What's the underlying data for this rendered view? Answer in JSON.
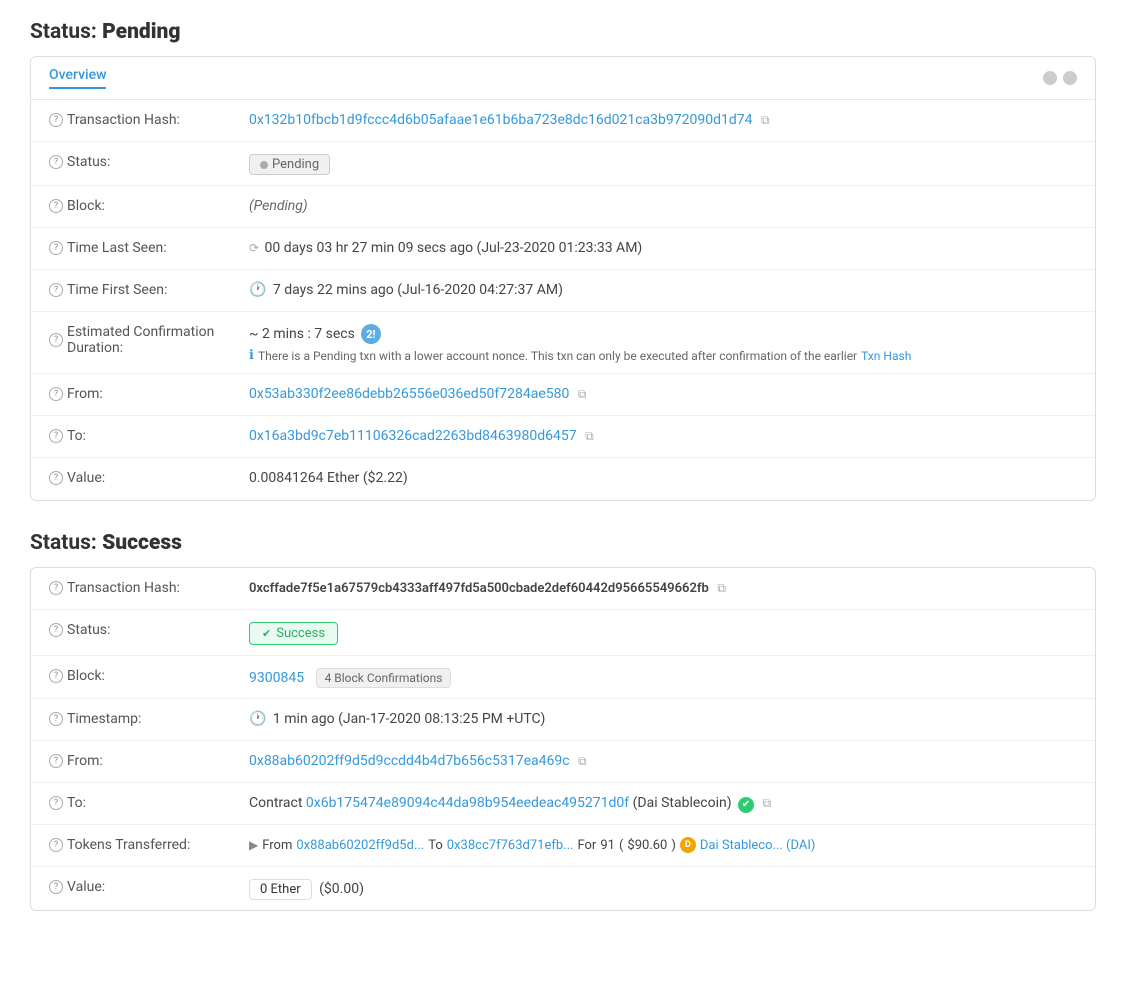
{
  "pending": {
    "section_title": "Status:",
    "section_status": "Pending",
    "tab_label": "Overview",
    "fields": {
      "transaction_hash": {
        "label": "Transaction Hash:",
        "value": "0x132b10fbcb1d9fccc4d6b05afaae1e61b6ba723e8dc16d021ca3b972090d1d74"
      },
      "status": {
        "label": "Status:",
        "badge": "Pending"
      },
      "block": {
        "label": "Block:",
        "value": "(Pending)"
      },
      "time_last_seen": {
        "label": "Time Last Seen:",
        "value": "00 days 03 hr 27 min 09 secs ago (Jul-23-2020 01:23:33 AM)"
      },
      "time_first_seen": {
        "label": "Time First Seen:",
        "value": "7 days 22 mins ago (Jul-16-2020 04:27:37 AM)"
      },
      "estimated_confirmation": {
        "label": "Estimated Confirmation Duration:",
        "value": "~ 2 mins : 7 secs",
        "note": "There is a Pending txn with a lower account nonce. This txn can only be executed after confirmation of the earlier",
        "note_link": "Txn Hash"
      },
      "from": {
        "label": "From:",
        "value": "0x53ab330f2ee86debb26556e036ed50f7284ae580"
      },
      "to": {
        "label": "To:",
        "value": "0x16a3bd9c7eb11106326cad2263bd8463980d6457"
      },
      "value": {
        "label": "Value:",
        "value": "0.00841264 Ether ($2.22)"
      }
    }
  },
  "success": {
    "section_title": "Status:",
    "section_status": "Success",
    "fields": {
      "transaction_hash": {
        "label": "Transaction Hash:",
        "value": "0xcffade7f5e1a67579cb4333aff497fd5a500cbade2def60442d95665549662fb"
      },
      "status": {
        "label": "Status:",
        "badge": "Success"
      },
      "block": {
        "label": "Block:",
        "block_number": "9300845",
        "confirmations": "4 Block Confirmations"
      },
      "timestamp": {
        "label": "Timestamp:",
        "value": "1 min ago (Jan-17-2020 08:13:25 PM +UTC)"
      },
      "from": {
        "label": "From:",
        "value": "0x88ab60202ff9d5d9ccdd4b4d7b656c5317ea469c"
      },
      "to": {
        "label": "To:",
        "contract_prefix": "Contract",
        "contract_address": "0x6b175474e89094c44da98b954eedeac495271d0f",
        "contract_name": "(Dai Stablecoin)"
      },
      "tokens_transferred": {
        "label": "Tokens Transferred:",
        "from_short": "0x88ab60202ff9d5d...",
        "to_short": "0x38cc7f763d71efb...",
        "amount": "91",
        "usd": "$90.60",
        "token_name": "Dai Stableco... (DAI)"
      },
      "value": {
        "label": "Value:",
        "eth_value": "0 Ether",
        "usd_value": "($0.00)"
      }
    }
  }
}
